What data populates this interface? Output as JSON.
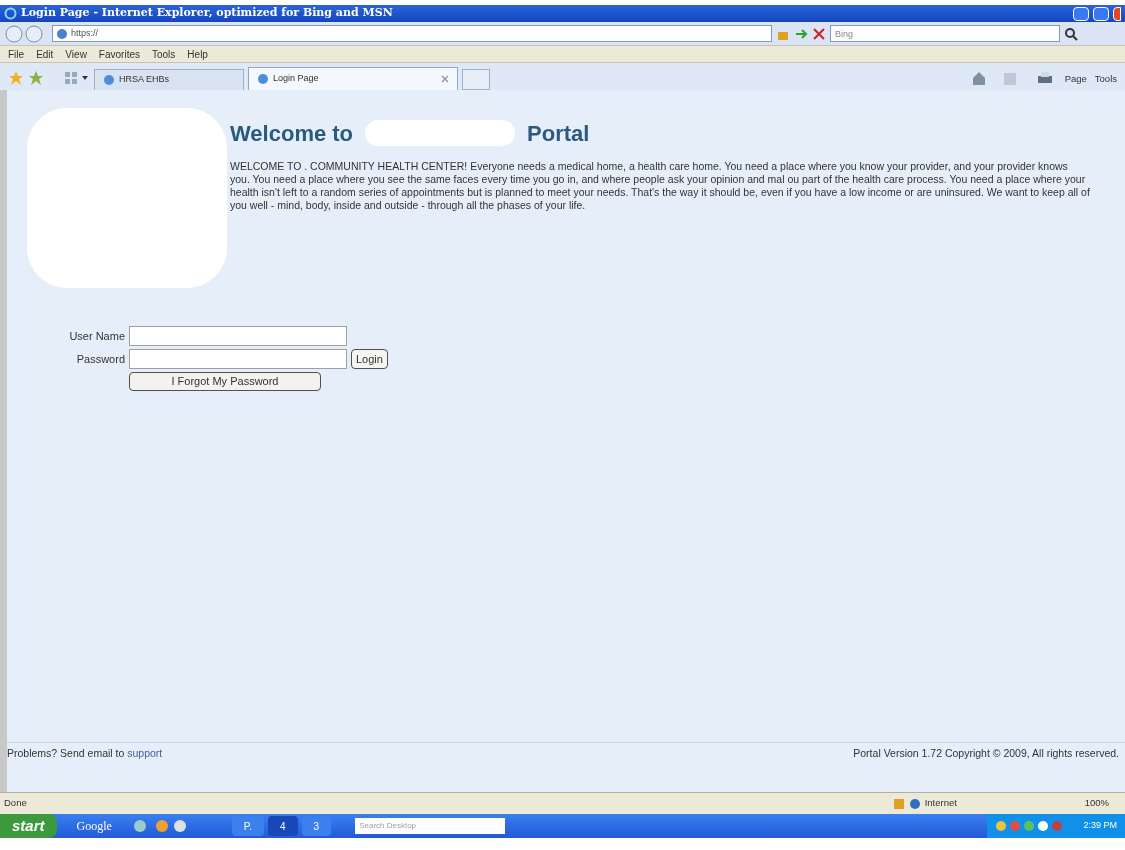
{
  "window": {
    "title": "Login Page - Internet Explorer, optimized for Bing and MSN"
  },
  "address": {
    "url": "https://"
  },
  "search": {
    "placeholder": "Bing"
  },
  "menu": [
    "File",
    "Edit",
    "View",
    "Favorites",
    "Tools",
    "Help"
  ],
  "tabs": [
    {
      "label": "HRSA EHBs",
      "selected": false
    },
    {
      "label": "Login Page",
      "selected": true
    }
  ],
  "command_bar": [
    "Page",
    "Tools"
  ],
  "page": {
    "heading_start": "Welcome to",
    "heading_end": "Portal",
    "intro": "WELCOME TO . COMMUNITY HEALTH CENTER! Everyone needs a medical home, a health care home. You need a place where you know your provider, and your provider knows you. You need a place where you see the same faces every time you go in, and where people ask your opinion and mal ou part of the health care process. You need a place where your health isn't left to a random series of appointments but is planned to meet your needs. That's the way it should be, even if you have a low income or are uninsured. We want to keep all of you well - mind, body, inside and outside - through all the phases of your life.",
    "username_label": "User Name",
    "password_label": "Password",
    "login_button": "Login",
    "forgot_button": "I Forgot My Password",
    "footer_text": "Problems? Send email to",
    "footer_link": "support",
    "version": "Portal Version 1.72 Copyright © 2009, All rights reserved."
  },
  "status_bar": {
    "text": "Done",
    "zone": "Internet",
    "zoom": "100%"
  },
  "taskbar": {
    "start": "start",
    "toolbar": "Google",
    "tasks": [
      {
        "label": "P.",
        "selected": false
      },
      {
        "label": "4",
        "selected": true
      },
      {
        "label": "3",
        "selected": false
      }
    ],
    "search_placeholder": "Search Desktop",
    "clock": "2:39 PM"
  }
}
